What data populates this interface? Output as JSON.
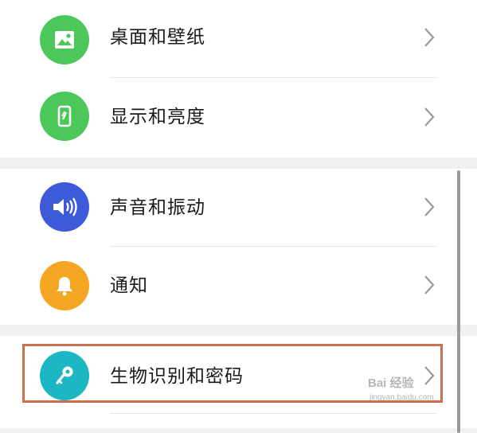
{
  "settings": {
    "items": [
      {
        "label": "桌面和壁纸",
        "icon": "image-icon",
        "color": "#4cc85b"
      },
      {
        "label": "显示和亮度",
        "icon": "phone-brightness-icon",
        "color": "#4cc85b"
      },
      {
        "label": "声音和振动",
        "icon": "speaker-icon",
        "color": "#3d5bd8"
      },
      {
        "label": "通知",
        "icon": "bell-icon",
        "color": "#f5a623"
      },
      {
        "label": "生物识别和密码",
        "icon": "key-icon",
        "color": "#1db7c4"
      }
    ]
  },
  "watermark": {
    "text": "Bai 经验",
    "sub": "jingyan.baidu.com"
  }
}
